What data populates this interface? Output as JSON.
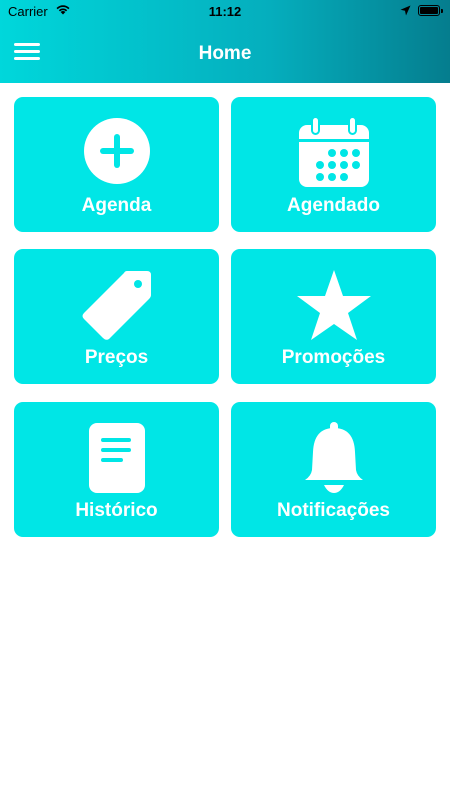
{
  "status_bar": {
    "carrier": "Carrier",
    "time": "11:12"
  },
  "header": {
    "title": "Home"
  },
  "tiles": [
    {
      "label": "Agenda",
      "icon": "plus-circle-icon"
    },
    {
      "label": "Agendado",
      "icon": "calendar-icon"
    },
    {
      "label": "Preços",
      "icon": "price-tag-icon"
    },
    {
      "label": "Promoções",
      "icon": "star-icon"
    },
    {
      "label": "Histórico",
      "icon": "document-icon"
    },
    {
      "label": "Notificações",
      "icon": "bell-icon"
    }
  ],
  "colors": {
    "tile": "#00e6e6",
    "header_start": "#00d7db",
    "header_end": "#057d8e"
  }
}
